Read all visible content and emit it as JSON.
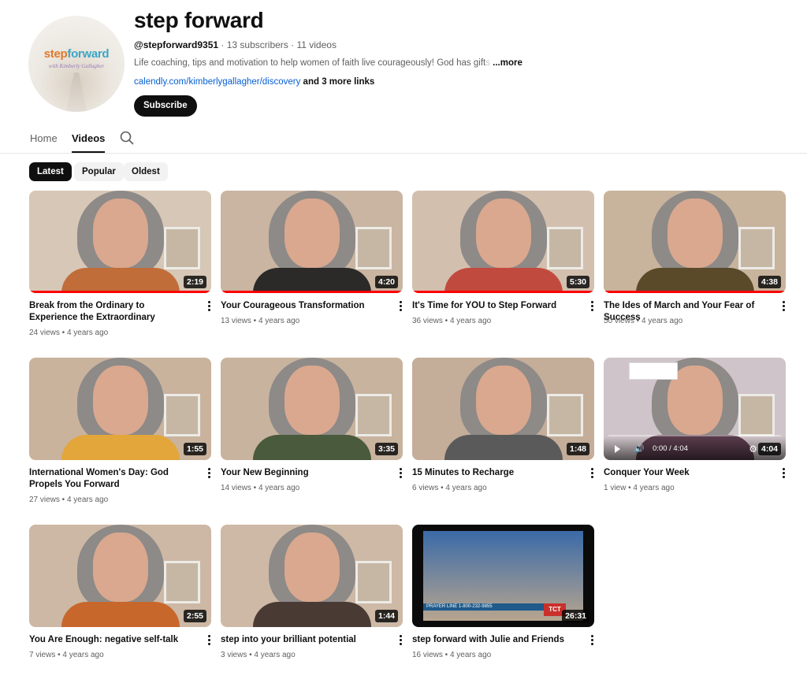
{
  "channel": {
    "name": "step forward",
    "handle": "@stepforward9351",
    "subscribers": "13 subscribers",
    "video_count": "11 videos",
    "separator": " · ",
    "description": "Life coaching, tips and motivation to help women of faith live courageously! God has gift",
    "description_faded": "s",
    "more_label": "...more",
    "link": "calendly.com/kimberlygallagher/discovery",
    "more_links": " and 3 more links",
    "subscribe_label": "Subscribe",
    "avatar_logo_a": "step",
    "avatar_logo_b": "forward",
    "avatar_sub": "with Kimberly Gallagher"
  },
  "tabs": [
    {
      "label": "Home"
    },
    {
      "label": "Videos"
    }
  ],
  "chips": [
    {
      "label": "Latest"
    },
    {
      "label": "Popular"
    },
    {
      "label": "Oldest"
    }
  ],
  "videos": [
    {
      "title": "Break from the Ordinary to Experience the Extraordinary",
      "views": "24 views",
      "age": "4 years ago",
      "duration": "2:19",
      "watched": 1.0
    },
    {
      "title": "Your Courageous Transformation",
      "views": "13 views",
      "age": "4 years ago",
      "duration": "4:20",
      "watched": 1.0
    },
    {
      "title": "It's Time for YOU to Step Forward",
      "views": "36 views",
      "age": "4 years ago",
      "duration": "5:30",
      "watched": 1.0
    },
    {
      "title": "The Ides of March and Your Fear of Success",
      "views": "50 views",
      "age": "4 years ago",
      "duration": "4:38",
      "watched": 1.0
    },
    {
      "title": "International Women's Day: God Propels You Forward",
      "views": "27 views",
      "age": "4 years ago",
      "duration": "1:55",
      "watched": 0
    },
    {
      "title": "Your New Beginning",
      "views": "14 views",
      "age": "4 years ago",
      "duration": "3:35",
      "watched": 0
    },
    {
      "title": "15 Minutes to Recharge",
      "views": "6 views",
      "age": "4 years ago",
      "duration": "1:48",
      "watched": 0
    },
    {
      "title": "Conquer Your Week",
      "views": "1 view",
      "age": "4 years ago",
      "duration": "4:04",
      "player_time": "0:00 / 4:04",
      "watched": 0
    },
    {
      "title": "You Are Enough: negative self-talk",
      "views": "7 views",
      "age": "4 years ago",
      "duration": "2:55",
      "watched": 0
    },
    {
      "title": "step into your brilliant potential",
      "views": "3 views",
      "age": "4 years ago",
      "duration": "1:44",
      "watched": 0
    },
    {
      "title": "step forward with Julie and Friends",
      "views": "16 views",
      "age": "4 years ago",
      "duration": "26:31",
      "ticker": "PRAYER LINE  1-800-232-9855",
      "badge": "TCT",
      "watched": 0
    }
  ],
  "colors": {
    "accent": "#ff0000",
    "link": "#065fd4",
    "text": "#0f0f0f",
    "muted": "#606060"
  }
}
